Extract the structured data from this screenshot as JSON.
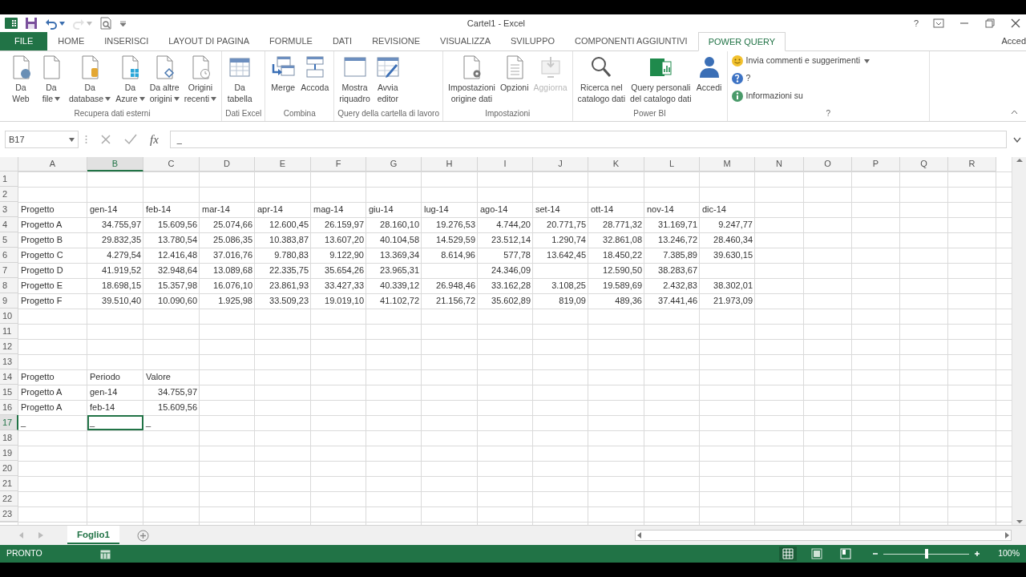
{
  "window": {
    "title": "Cartel1 - Excel",
    "help": "?"
  },
  "quick_access": [
    {
      "kind": "save",
      "disabled": false
    },
    {
      "kind": "undo",
      "disabled": false
    },
    {
      "kind": "redo",
      "disabled": true
    },
    {
      "kind": "preview",
      "disabled": false
    }
  ],
  "ribbon_tabs": [
    {
      "label": "FILE",
      "kind": "file",
      "selected": false
    },
    {
      "label": "HOME",
      "kind": "tab",
      "selected": false
    },
    {
      "label": "INSERISCI",
      "kind": "tab",
      "selected": false
    },
    {
      "label": "LAYOUT DI PAGINA",
      "kind": "tab",
      "selected": false
    },
    {
      "label": "FORMULE",
      "kind": "tab",
      "selected": false
    },
    {
      "label": "DATI",
      "kind": "tab",
      "selected": false
    },
    {
      "label": "REVISIONE",
      "kind": "tab",
      "selected": false
    },
    {
      "label": "VISUALIZZA",
      "kind": "tab",
      "selected": false
    },
    {
      "label": "SVILUPPO",
      "kind": "tab",
      "selected": false
    },
    {
      "label": "COMPONENTI AGGIUNTIVI",
      "kind": "tab",
      "selected": false
    },
    {
      "label": "POWER QUERY",
      "kind": "tab",
      "selected": true
    }
  ],
  "account": "Acced",
  "ribbon": {
    "groups": [
      {
        "label": "Recupera dati esterni",
        "buttons": [
          {
            "lines": [
              "Da",
              "Web"
            ],
            "dropdown": false,
            "disabled": false
          },
          {
            "lines": [
              "Da",
              "file"
            ],
            "dropdown": true,
            "disabled": false
          },
          {
            "lines": [
              "Da",
              "database"
            ],
            "dropdown": true,
            "disabled": false
          },
          {
            "lines": [
              "Da",
              "Azure"
            ],
            "dropdown": true,
            "disabled": false
          },
          {
            "lines": [
              "Da altre",
              "origini"
            ],
            "dropdown": true,
            "disabled": false
          },
          {
            "lines": [
              "Origini",
              "recenti"
            ],
            "dropdown": true,
            "disabled": false
          }
        ]
      },
      {
        "label": "Dati Excel",
        "buttons": [
          {
            "lines": [
              "Da",
              "tabella"
            ],
            "dropdown": false,
            "disabled": false
          }
        ]
      },
      {
        "label": "Combina",
        "buttons": [
          {
            "lines": [
              "Merge"
            ],
            "dropdown": false,
            "disabled": false
          },
          {
            "lines": [
              "Accoda"
            ],
            "dropdown": false,
            "disabled": false
          }
        ]
      },
      {
        "label": "Query della cartella di lavoro",
        "buttons": [
          {
            "lines": [
              "Mostra",
              "riquadro"
            ],
            "dropdown": false,
            "disabled": false
          },
          {
            "lines": [
              "Avvia",
              "editor"
            ],
            "dropdown": false,
            "disabled": false
          }
        ]
      },
      {
        "label": "Impostazioni",
        "buttons": [
          {
            "lines": [
              "Impostazioni",
              "origine dati"
            ],
            "dropdown": false,
            "disabled": false
          },
          {
            "lines": [
              "Opzioni"
            ],
            "dropdown": false,
            "disabled": false
          },
          {
            "lines": [
              "Aggiorna"
            ],
            "dropdown": false,
            "disabled": true
          }
        ]
      },
      {
        "label": "Power BI",
        "buttons": [
          {
            "lines": [
              "Ricerca nel",
              "catalogo dati"
            ],
            "dropdown": false,
            "disabled": false
          },
          {
            "lines": [
              "Query personali",
              "del catalogo dati"
            ],
            "dropdown": false,
            "disabled": false
          },
          {
            "lines": [
              "Accedi"
            ],
            "dropdown": false,
            "disabled": false
          }
        ]
      },
      {
        "label": "?",
        "links": [
          {
            "text": "Invia commenti e suggerimenti",
            "dropdown": true
          },
          {
            "text": "?",
            "dropdown": false
          },
          {
            "text": "Informazioni su",
            "dropdown": false
          }
        ]
      }
    ]
  },
  "formula_bar": {
    "name_box": "B17",
    "function_label": "fx",
    "value": "_"
  },
  "sheet": {
    "columns": [
      {
        "letter": "A",
        "selected": false
      },
      {
        "letter": "B",
        "selected": true
      },
      {
        "letter": "C",
        "selected": false
      },
      {
        "letter": "D",
        "selected": false
      },
      {
        "letter": "E",
        "selected": false
      },
      {
        "letter": "F",
        "selected": false
      },
      {
        "letter": "G",
        "selected": false
      },
      {
        "letter": "H",
        "selected": false
      },
      {
        "letter": "I",
        "selected": false
      },
      {
        "letter": "J",
        "selected": false
      },
      {
        "letter": "K",
        "selected": false
      },
      {
        "letter": "L",
        "selected": false
      },
      {
        "letter": "M",
        "selected": false
      },
      {
        "letter": "N",
        "selected": false
      },
      {
        "letter": "O",
        "selected": false
      },
      {
        "letter": "P",
        "selected": false
      },
      {
        "letter": "Q",
        "selected": false
      },
      {
        "letter": "R",
        "selected": false
      }
    ],
    "rows": [
      {
        "number": "1",
        "selected": false
      },
      {
        "number": "2",
        "selected": false
      },
      {
        "number": "3",
        "selected": false,
        "cells": [
          "Progetto",
          "gen-14",
          "feb-14",
          "mar-14",
          "apr-14",
          "mag-14",
          "giu-14",
          "lug-14",
          "ago-14",
          "set-14",
          "ott-14",
          "nov-14",
          "dic-14"
        ]
      },
      {
        "number": "4",
        "selected": false,
        "cells": [
          "Progetto A",
          "34.755,97",
          "15.609,56",
          "25.074,66",
          "12.600,45",
          "26.159,97",
          "28.160,10",
          "19.276,53",
          "4.744,20",
          "20.771,75",
          "28.771,32",
          "31.169,71",
          "9.247,77"
        ]
      },
      {
        "number": "5",
        "selected": false,
        "cells": [
          "Progetto B",
          "29.832,35",
          "13.780,54",
          "25.086,35",
          "10.383,87",
          "13.607,20",
          "40.104,58",
          "14.529,59",
          "23.512,14",
          "1.290,74",
          "32.861,08",
          "13.246,72",
          "28.460,34"
        ]
      },
      {
        "number": "6",
        "selected": false,
        "cells": [
          "Progetto C",
          "4.279,54",
          "12.416,48",
          "37.016,76",
          "9.780,83",
          "9.122,90",
          "13.369,34",
          "8.614,96",
          "577,78",
          "13.642,45",
          "18.450,22",
          "7.385,89",
          "39.630,15"
        ]
      },
      {
        "number": "7",
        "selected": false,
        "cells": [
          "Progetto D",
          "41.919,52",
          "32.948,64",
          "13.089,68",
          "22.335,75",
          "35.654,26",
          "23.965,31",
          null,
          "24.346,09",
          null,
          "12.590,50",
          "38.283,67"
        ]
      },
      {
        "number": "8",
        "selected": false,
        "cells": [
          "Progetto E",
          "18.698,15",
          "15.357,98",
          "16.076,10",
          "23.861,93",
          "33.427,33",
          "40.339,12",
          "26.948,46",
          "33.162,28",
          "3.108,25",
          "19.589,69",
          "2.432,83",
          "38.302,01"
        ]
      },
      {
        "number": "9",
        "selected": false,
        "cells": [
          "Progetto F",
          "39.510,40",
          "10.090,60",
          "1.925,98",
          "33.509,23",
          "19.019,10",
          "41.102,72",
          "21.156,72",
          "35.602,89",
          "819,09",
          "489,36",
          "37.441,46",
          "21.973,09"
        ]
      },
      {
        "number": "10",
        "selected": false
      },
      {
        "number": "11",
        "selected": false
      },
      {
        "number": "12",
        "selected": false
      },
      {
        "number": "13",
        "selected": false
      },
      {
        "number": "14",
        "selected": false,
        "cells": [
          "Progetto",
          "Periodo",
          "Valore"
        ]
      },
      {
        "number": "15",
        "selected": false,
        "cells": [
          "Progetto A",
          "gen-14",
          "34.755,97"
        ]
      },
      {
        "number": "16",
        "selected": false,
        "cells": [
          "Progetto A",
          "feb-14",
          "15.609,56"
        ]
      },
      {
        "number": "17",
        "selected": true,
        "cells": [
          "_",
          "_",
          "_"
        ]
      },
      {
        "number": "18",
        "selected": false
      },
      {
        "number": "19",
        "selected": false
      },
      {
        "number": "20",
        "selected": false
      },
      {
        "number": "21",
        "selected": false
      },
      {
        "number": "22",
        "selected": false
      },
      {
        "number": "23",
        "selected": false
      }
    ]
  },
  "sheet_tabs": [
    {
      "label": "Foglio1",
      "selected": true
    }
  ],
  "status_bar": {
    "mode": "PRONTO",
    "views": [
      {
        "kind": "normal",
        "selected": true
      },
      {
        "kind": "page-layout",
        "selected": false
      },
      {
        "kind": "page-break",
        "selected": false
      }
    ],
    "zoom": {
      "level": 0.5,
      "label": "100%"
    }
  }
}
